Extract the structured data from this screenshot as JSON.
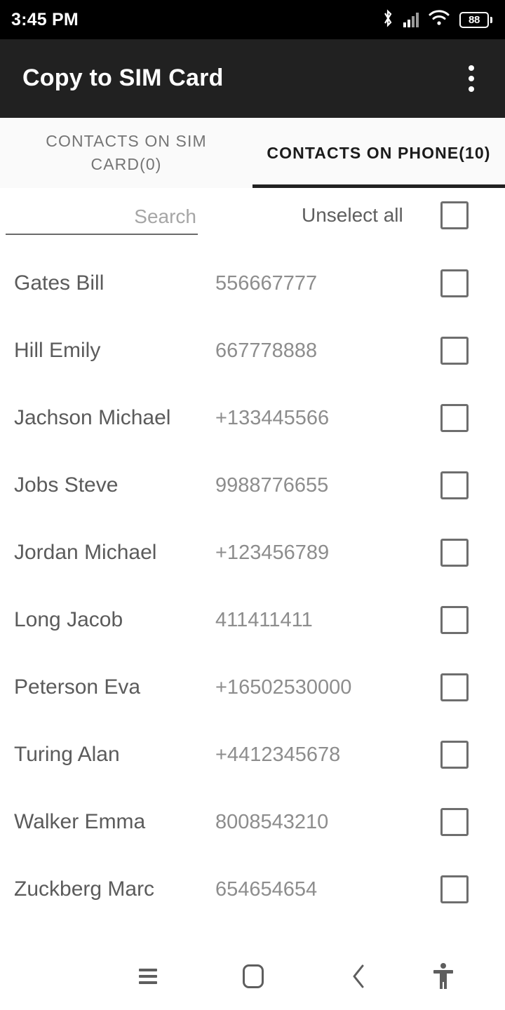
{
  "status_bar": {
    "time": "3:45 PM",
    "icons": [
      "bluetooth-icon",
      "signal-icon",
      "wifi-icon",
      "battery-icon"
    ],
    "battery_level": "88"
  },
  "app_bar": {
    "title": "Copy to SIM Card",
    "overflow_icon": "more-vertical-icon"
  },
  "tabs": [
    {
      "label": "CONTACTS ON SIM CARD(0)",
      "active": false,
      "count": 0
    },
    {
      "label": "CONTACTS ON PHONE(10)",
      "active": true,
      "count": 10
    }
  ],
  "filter_row": {
    "search_placeholder": "Search",
    "search_value": "",
    "select_all_label": "Unselect all",
    "select_all_checked": false
  },
  "contacts": [
    {
      "name": "Gates Bill",
      "number": "556667777",
      "checked": false
    },
    {
      "name": "Hill Emily",
      "number": "667778888",
      "checked": false
    },
    {
      "name": "Jachson Michael",
      "number": "+133445566",
      "checked": false
    },
    {
      "name": "Jobs Steve",
      "number": "9988776655",
      "checked": false
    },
    {
      "name": "Jordan Michael",
      "number": "+123456789",
      "checked": false
    },
    {
      "name": "Long Jacob",
      "number": "411411411",
      "checked": false
    },
    {
      "name": "Peterson Eva",
      "number": "+16502530000",
      "checked": false
    },
    {
      "name": "Turing Alan",
      "number": "+4412345678",
      "checked": false
    },
    {
      "name": "Walker Emma",
      "number": "8008543210",
      "checked": false
    },
    {
      "name": "Zuckberg Marc",
      "number": "654654654",
      "checked": false
    }
  ],
  "nav_bar": {
    "items": [
      {
        "name": "recents-icon"
      },
      {
        "name": "home-icon"
      },
      {
        "name": "back-icon"
      },
      {
        "name": "accessibility-icon"
      }
    ]
  },
  "colors": {
    "status_bar_bg": "#000000",
    "app_bar_bg": "#212121",
    "tab_active": "#1b1b1b",
    "tab_inactive": "#757575",
    "name_text": "#5b5b5b",
    "number_text": "#8d8d8d",
    "checkbox_border": "#6e6e6e"
  }
}
